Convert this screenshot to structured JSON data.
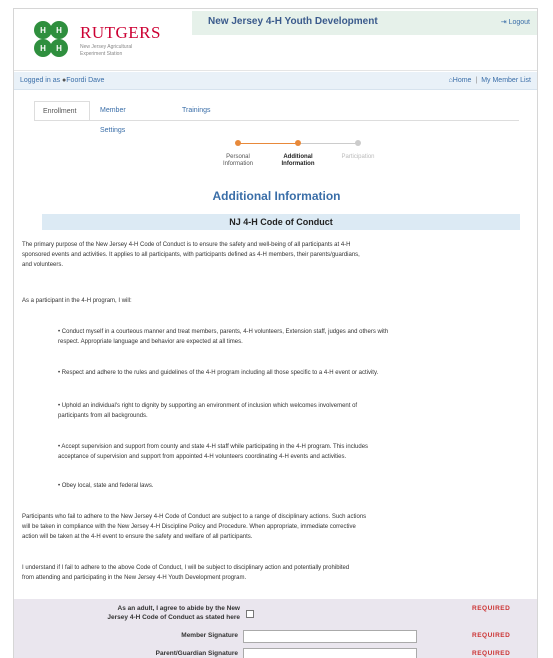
{
  "header": {
    "brand_name": "RUTGERS",
    "brand_sub_line1": "New Jersey Agricultural",
    "brand_sub_line2": "Experiment Station",
    "logo_icon": "four-leaf-clover-icon",
    "title": "New Jersey 4-H Youth Development",
    "logout_label": "Logout",
    "logout_icon": "logout-icon"
  },
  "userbar": {
    "logged_in_prefix": "Logged in as",
    "user_icon": "user-icon",
    "user_name": "Foordi Dave",
    "home_icon": "home-icon",
    "home_label": "Home",
    "separator": "|",
    "member_list_label": "My Member List"
  },
  "tabs": [
    {
      "label": "Enrollment",
      "active": true
    },
    {
      "label": "Member Settings",
      "active": false
    },
    {
      "label": "Trainings",
      "active": false
    }
  ],
  "stepper": {
    "steps": [
      {
        "line1": "Personal",
        "line2": "Information",
        "state": "done"
      },
      {
        "line1": "Additional",
        "line2": "Information",
        "state": "current"
      },
      {
        "line1": "Participation",
        "line2": "",
        "state": "todo"
      }
    ],
    "colors": {
      "done": "#e8893a",
      "todo": "#cccccc"
    }
  },
  "section_title": "Additional Information",
  "code_of_conduct": {
    "heading": "NJ 4-H Code of Conduct",
    "intro_line1": "The primary purpose of the New Jersey 4-H Code of Conduct is to ensure the safety and well-being of all participants at 4-H",
    "intro_line2": "sponsored events and activities. It applies to all participants, with participants defined as 4-H members, their parents/guardians,",
    "intro_line3": "and volunteers.",
    "pledge_intro": "As a participant in the 4-H program, I will:",
    "bullets": [
      {
        "line1": "• Conduct myself in a courteous manner and treat members, parents, 4-H volunteers, Extension staff, judges and others with",
        "line2": "respect. Appropriate language and behavior are expected at all times."
      },
      {
        "line1": "• Respect and adhere to the rules and guidelines of the 4-H program including all those specific to a 4-H event or activity.",
        "line2": ""
      },
      {
        "line1": "• Uphold an individual's right to dignity by supporting an environment of inclusion which welcomes involvement of",
        "line2": "participants from all backgrounds."
      },
      {
        "line1": "• Accept supervision and support from county and state 4-H staff while participating in the 4-H program. This includes",
        "line2": "acceptance of supervision and support from appointed 4-H volunteers coordinating 4-H events and activities."
      },
      {
        "line1": "• Obey local, state and federal laws.",
        "line2": ""
      }
    ],
    "consequence_line1": "Participants who fail to adhere to the New Jersey 4-H Code of Conduct are subject to a range of disciplinary actions. Such actions",
    "consequence_line2": "will be taken in compliance with the New Jersey 4-H Discipline Policy and Procedure. When appropriate, immediate corrective",
    "consequence_line3": "action will be taken at the 4-H event to ensure the safety and welfare of all participants.",
    "understand_line1": "I understand if I fail to adhere to the above Code of Conduct, I will be subject to disciplinary action and potentially prohibited",
    "understand_line2": "from attending and participating in the New Jersey 4-H Youth Development program."
  },
  "consent": {
    "agree_line1": "As an adult, I agree to abide by the New",
    "agree_line2": "Jersey 4-H Code of Conduct as stated here",
    "member_signature_label": "Member Signature",
    "member_signature_value": "",
    "parent_signature_label": "Parent/Guardian Signature",
    "parent_signature_value": "",
    "required_label": "REQUIRED",
    "agreed": false
  },
  "colors": {
    "brand_red": "#cc0033",
    "link_blue": "#3a6ea8",
    "required_red": "#cc3333",
    "title_bar_bg": "#e6f1ea",
    "section_bar_bg": "#dceaf4",
    "consent_bg": "#eae6ee"
  }
}
